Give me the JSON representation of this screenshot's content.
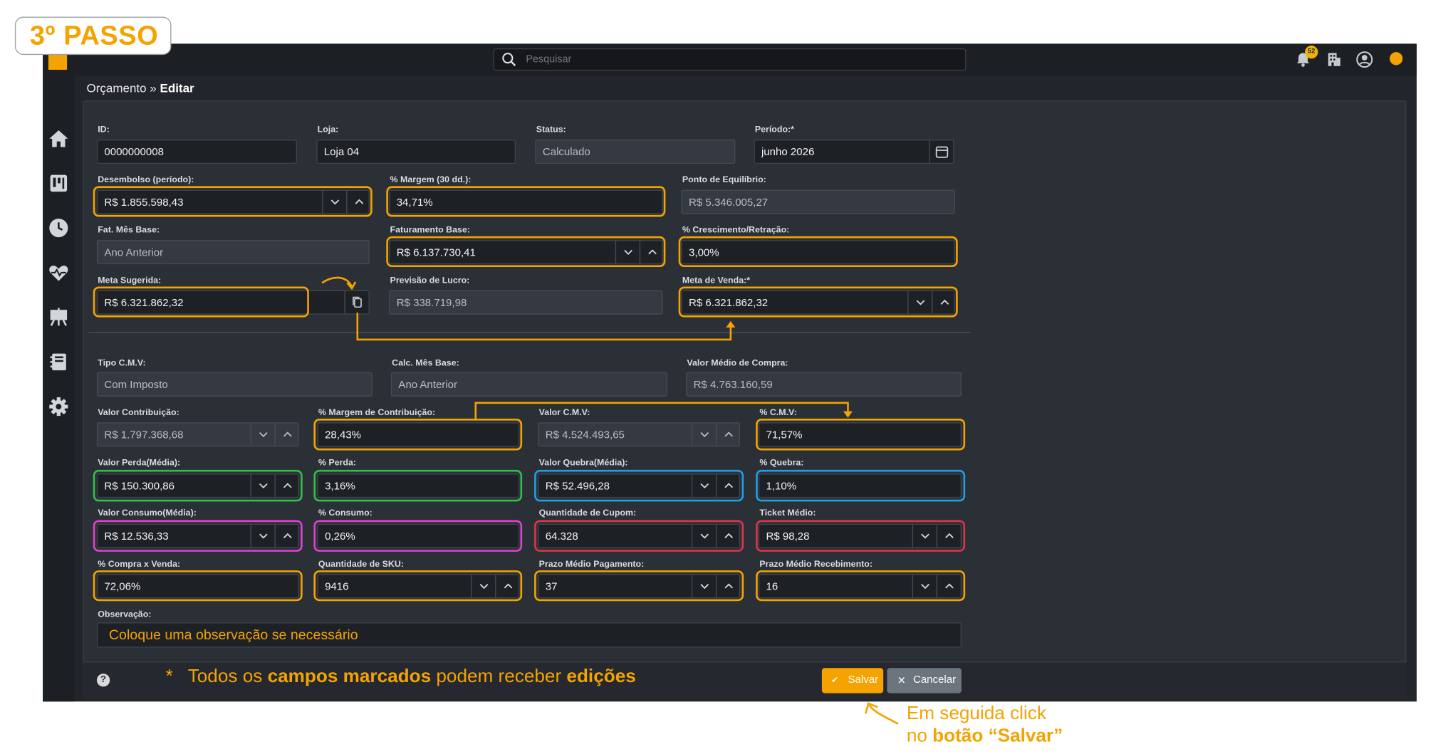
{
  "step_badge": "3º PASSO",
  "header": {
    "search_placeholder": "Pesquisar",
    "notification_count": "52"
  },
  "breadcrumb": {
    "section": "Orçamento",
    "separator": " » ",
    "page": "Editar"
  },
  "form": {
    "id": {
      "label": "ID:",
      "value": "0000000008"
    },
    "loja": {
      "label": "Loja:",
      "value": "Loja 04"
    },
    "status": {
      "label": "Status:",
      "value": "Calculado"
    },
    "periodo": {
      "label": "Período:*",
      "value": "junho 2026"
    },
    "desembolso": {
      "label": "Desembolso (período):",
      "value": "R$ 1.855.598,43"
    },
    "margem30": {
      "label": "% Margem (30 dd.):",
      "value": "34,71%"
    },
    "ponto_equilibrio": {
      "label": "Ponto de Equilíbrio:",
      "value": "R$ 5.346.005,27"
    },
    "fat_mes_base": {
      "label": "Fat. Mês Base:",
      "value": "Ano Anterior"
    },
    "faturamento_base": {
      "label": "Faturamento Base:",
      "value": "R$ 6.137.730,41"
    },
    "crescimento": {
      "label": "% Crescimento/Retração:",
      "value": "3,00%"
    },
    "meta_sugerida": {
      "label": "Meta Sugerida:",
      "value": "R$ 6.321.862,32"
    },
    "previsao_lucro": {
      "label": "Previsão de Lucro:",
      "value": "R$ 338.719,98"
    },
    "meta_venda": {
      "label": "Meta de Venda:*",
      "value": "R$ 6.321.862,32"
    },
    "tipo_cmv": {
      "label": "Tipo C.M.V:",
      "value": "Com Imposto"
    },
    "calc_mes_base": {
      "label": "Calc. Mês Base:",
      "value": "Ano Anterior"
    },
    "valor_medio_compra": {
      "label": "Valor Médio de Compra:",
      "value": "R$ 4.763.160,59"
    },
    "valor_contribuicao": {
      "label": "Valor Contribuição:",
      "value": "R$ 1.797.368,68"
    },
    "margem_contribuicao": {
      "label": "% Margem de Contribuição:",
      "value": "28,43%"
    },
    "valor_cmv": {
      "label": "Valor C.M.V:",
      "value": "R$ 4.524.493,65"
    },
    "pct_cmv": {
      "label": "% C.M.V:",
      "value": "71,57%"
    },
    "valor_perda": {
      "label": "Valor Perda(Média):",
      "value": "R$ 150.300,86"
    },
    "pct_perda": {
      "label": "% Perda:",
      "value": "3,16%"
    },
    "valor_quebra": {
      "label": "Valor Quebra(Média):",
      "value": "R$ 52.496,28"
    },
    "pct_quebra": {
      "label": "% Quebra:",
      "value": "1,10%"
    },
    "valor_consumo": {
      "label": "Valor Consumo(Média):",
      "value": "R$ 12.536,33"
    },
    "pct_consumo": {
      "label": "% Consumo:",
      "value": "0,26%"
    },
    "qtd_cupom": {
      "label": "Quantidade de Cupom:",
      "value": "64.328"
    },
    "ticket_medio": {
      "label": "Ticket Médio:",
      "value": "R$ 98,28"
    },
    "compra_venda": {
      "label": "% Compra x Venda:",
      "value": "72,06%"
    },
    "qtd_sku": {
      "label": "Quantidade de SKU:",
      "value": "9416"
    },
    "prazo_pagamento": {
      "label": "Prazo Médio Pagamento:",
      "value": "37"
    },
    "prazo_recebimento": {
      "label": "Prazo Médio Recebimento:",
      "value": "16"
    },
    "observacao": {
      "label": "Observação:",
      "value": "Coloque uma observação se necessário"
    }
  },
  "footer": {
    "help": "?",
    "note_star": "*",
    "note_part1": "Todos os ",
    "note_bold1": "campos marcados",
    "note_part2": " podem receber ",
    "note_bold2": "edições",
    "save_label": "Salvar",
    "cancel_label": "Cancelar"
  },
  "tip": {
    "line1": "Em seguida click",
    "line2_prefix": "no ",
    "line2_bold": "botão “Salvar”"
  },
  "colors": {
    "accent": "#f4a300",
    "highlight_green": "#2ec04a",
    "highlight_blue": "#1f9fe6",
    "highlight_pink": "#e040d0",
    "highlight_red": "#e0334a"
  }
}
